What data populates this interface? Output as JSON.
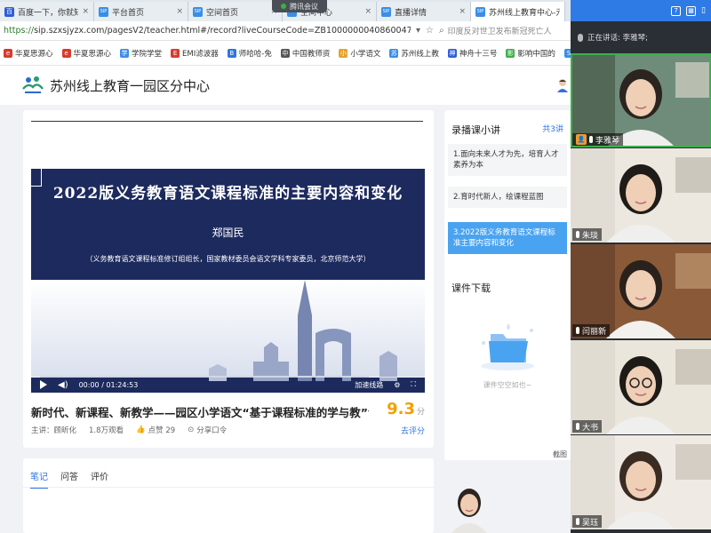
{
  "browser": {
    "tabs": [
      {
        "title": "百度一下，你就知道",
        "fav_color": "#2f5fd7",
        "fav_text": "百"
      },
      {
        "title": "平台首页",
        "fav_color": "#3a8ee6",
        "fav_text": "SIP"
      },
      {
        "title": "空间首页",
        "fav_color": "#3a8ee6",
        "fav_text": "SIP"
      },
      {
        "title": "空间中心",
        "fav_color": "#3a8ee6",
        "fav_text": "SIP"
      },
      {
        "title": "直播详情",
        "fav_color": "#3a8ee6",
        "fav_text": "SIP"
      },
      {
        "title": "苏州线上教育中心-元",
        "fav_color": "#3a8ee6",
        "fav_text": "SIP"
      }
    ],
    "tab_close": "×",
    "meeting_pill": "腾讯会议",
    "url_proto": "https://",
    "url_rest": "sip.szxsjyzx.com/pagesV2/teacher.html#/record?liveCourseCode=ZB1000000040860047848",
    "search_hint": "印度反对世卫发布新冠死亡人",
    "bookmarks": [
      {
        "label": "华夏思源心",
        "color": "#d93a2b",
        "icon": "e"
      },
      {
        "label": "华夏思源心",
        "color": "#d93a2b",
        "icon": "e"
      },
      {
        "label": "学院学堂",
        "color": "#3a8ee6",
        "icon": "学"
      },
      {
        "label": "EMI滤波器",
        "color": "#d93a2b",
        "icon": "E"
      },
      {
        "label": "师哈哈-免",
        "color": "#2f74e0",
        "icon": "B"
      },
      {
        "label": "中国教师资",
        "color": "#555555",
        "icon": "中"
      },
      {
        "label": "小学语文",
        "color": "#e6a22e",
        "icon": "小"
      },
      {
        "label": "苏州线上教",
        "color": "#3a8ee6",
        "icon": "苏"
      },
      {
        "label": "神舟十三号",
        "color": "#2f5fd7",
        "icon": "神"
      },
      {
        "label": "影响中国的",
        "color": "#3cb04a",
        "icon": "影"
      },
      {
        "label": "平台首页",
        "color": "#3a8ee6",
        "icon": "S"
      }
    ]
  },
  "site": {
    "title": "苏州线上教育一园区分中心"
  },
  "video": {
    "slide_title": "2022版义务教育语文课程标准的主要内容和变化",
    "slide_author": "郑国民",
    "slide_subtitle": "（义务教育语文课程标准修订组组长，国家教材委员会语文学科专家委员，北京师范大学）",
    "time": "00:00 / 01:24:53",
    "speed_label": "加速线路"
  },
  "course": {
    "title": "新时代、新课程、新教学——园区小学语文“基于课程标准的学与教”专...",
    "score": "9.3",
    "score_unit": "分",
    "lecturer": "主讲：顾昕化",
    "views": "1.8万观看",
    "likes": "点赞 29",
    "share": "分享口令",
    "rate": "去评分"
  },
  "content_tabs": [
    "笔记",
    "问答",
    "评价"
  ],
  "side": {
    "heading": "录播课小讲",
    "count": "共3讲",
    "lessons": [
      "1.面向未来人才为先，培育人才素养为本",
      "2.育时代新人，绘课程蓝图",
      "3.2022版义务教育语文课程标准主要内容和变化"
    ],
    "active_lesson": 2,
    "download_heading": "课件下载",
    "empty_text": "课件空空如也~",
    "screenshot_label": "截图"
  },
  "meeting": {
    "top_badge": "7",
    "speaking_label": "正在讲话: 李雅琴;",
    "participants": [
      {
        "name": "李雅琴",
        "host": true,
        "speaking": true
      },
      {
        "name": "朱琰",
        "host": false,
        "speaking": false
      },
      {
        "name": "闫丽新",
        "host": false,
        "speaking": false
      },
      {
        "name": "大书",
        "host": false,
        "speaking": false
      },
      {
        "name": "吴珏",
        "host": false,
        "speaking": false
      }
    ]
  }
}
